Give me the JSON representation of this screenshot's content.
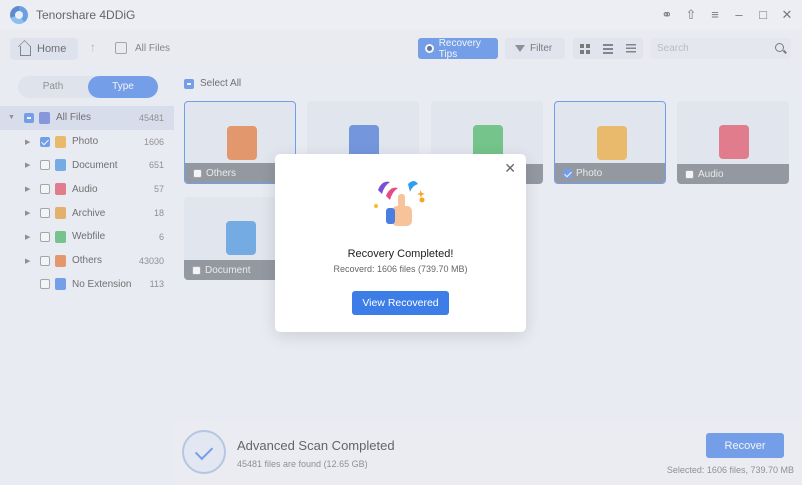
{
  "app": {
    "title": "Tenorshare 4DDiG"
  },
  "window_controls": [
    "headset-icon",
    "share-icon",
    "menu-icon",
    "minimize-icon",
    "maximize-icon",
    "close-icon"
  ],
  "toolbar": {
    "home_label": "Home",
    "path_label": "All Files",
    "tips_label": "Recovery Tips",
    "filter_label": "Filter",
    "search_placeholder": "Search"
  },
  "left_panel": {
    "tabs": [
      {
        "label": "Path",
        "active": false
      },
      {
        "label": "Type",
        "active": true
      }
    ],
    "tree": [
      {
        "label": "All Files",
        "count": "45481",
        "state": "partial",
        "icon_color": "#5b6fd6"
      },
      {
        "label": "Photo",
        "count": "1606",
        "state": "checked",
        "icon_color": "#f2a72a"
      },
      {
        "label": "Document",
        "count": "651",
        "state": "unchecked",
        "icon_color": "#3d8fe0"
      },
      {
        "label": "Audio",
        "count": "57",
        "state": "unchecked",
        "icon_color": "#e2485a"
      },
      {
        "label": "Archive",
        "count": "18",
        "state": "unchecked",
        "icon_color": "#e59a2a"
      },
      {
        "label": "Webfile",
        "count": "6",
        "state": "unchecked",
        "icon_color": "#3cb55a"
      },
      {
        "label": "Others",
        "count": "43030",
        "state": "unchecked",
        "icon_color": "#e5722a"
      },
      {
        "label": "No Extension",
        "count": "113",
        "state": "unchecked",
        "icon_color": "#3d7de8"
      }
    ]
  },
  "main": {
    "select_all_label": "Select All",
    "cards": [
      {
        "label": "Others",
        "checked": false,
        "selected": true,
        "icon_color": "#e5722a"
      },
      {
        "label": "",
        "checked": false,
        "selected": false,
        "icon_color": "#3d6fd6"
      },
      {
        "label": "",
        "checked": false,
        "selected": false,
        "icon_color": "#3cb55a"
      },
      {
        "label": "Photo",
        "checked": true,
        "selected": true,
        "icon_color": "#f2a72a"
      },
      {
        "label": "Audio",
        "checked": false,
        "selected": false,
        "icon_color": "#e2485a"
      },
      {
        "label": "Document",
        "checked": false,
        "selected": false,
        "icon_color": "#3d8fe0"
      }
    ]
  },
  "bottom": {
    "scan_title": "Advanced Scan Completed",
    "scan_subtitle": "45481 files are found (12.65 GB)",
    "recover_label": "Recover",
    "selected_info": "Selected: 1606 files, 739.70 MB"
  },
  "dialog": {
    "title": "Recovery Completed!",
    "subtitle": "Recoverd: 1606 files (739.70 MB)",
    "button_label": "View Recovered"
  },
  "colors": {
    "accent": "#3d7de8"
  }
}
